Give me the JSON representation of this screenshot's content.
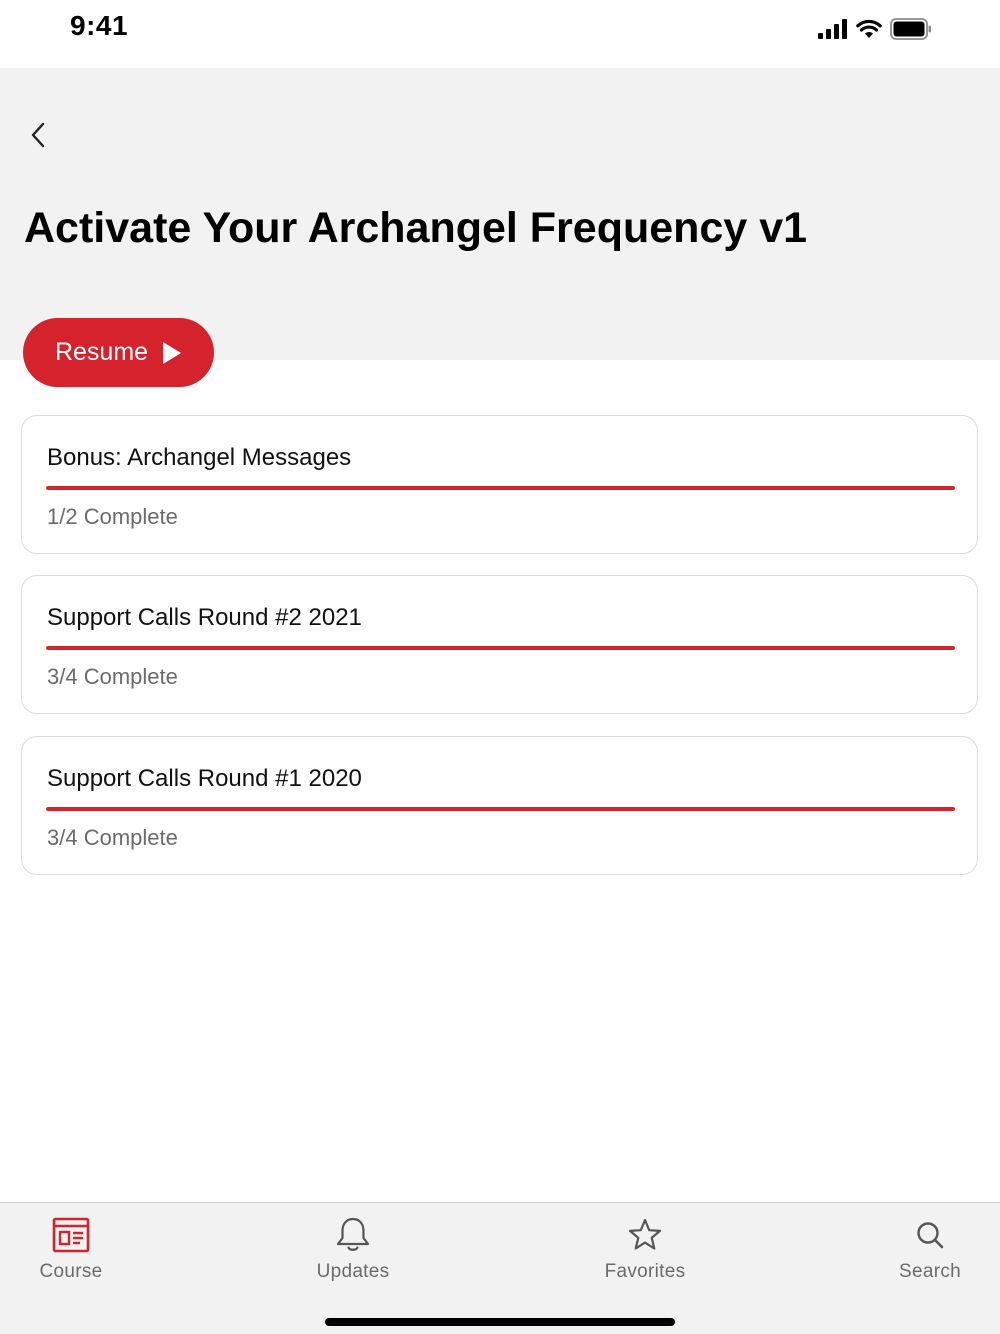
{
  "status_bar": {
    "time": "9:41",
    "icons": [
      "signal-icon",
      "wifi-icon",
      "battery-icon"
    ]
  },
  "header": {
    "back_icon": "chevron-left-icon",
    "title": "Activate Your Archangel Frequency v1",
    "resume_label": "Resume",
    "resume_icon": "play-icon"
  },
  "modules": [
    {
      "title": "Bonus: Archangel Messages",
      "status": "1/2 Complete",
      "progress": 1.0
    },
    {
      "title": "Support Calls Round #2 2021",
      "status": "3/4 Complete",
      "progress": 1.0
    },
    {
      "title": "Support Calls Round #1 2020",
      "status": "3/4 Complete",
      "progress": 1.0
    }
  ],
  "tab_bar": {
    "tabs": [
      {
        "label": "Course",
        "icon": "course-icon",
        "active": true
      },
      {
        "label": "Updates",
        "icon": "bell-icon",
        "active": false
      },
      {
        "label": "Favorites",
        "icon": "star-icon",
        "active": false
      },
      {
        "label": "Search",
        "icon": "search-icon",
        "active": false
      }
    ]
  },
  "colors": {
    "accent": "#d4232d",
    "header_bg": "#f2f2f2",
    "muted_text": "#6b6b6b",
    "tab_inactive": "#6b6b6b"
  }
}
